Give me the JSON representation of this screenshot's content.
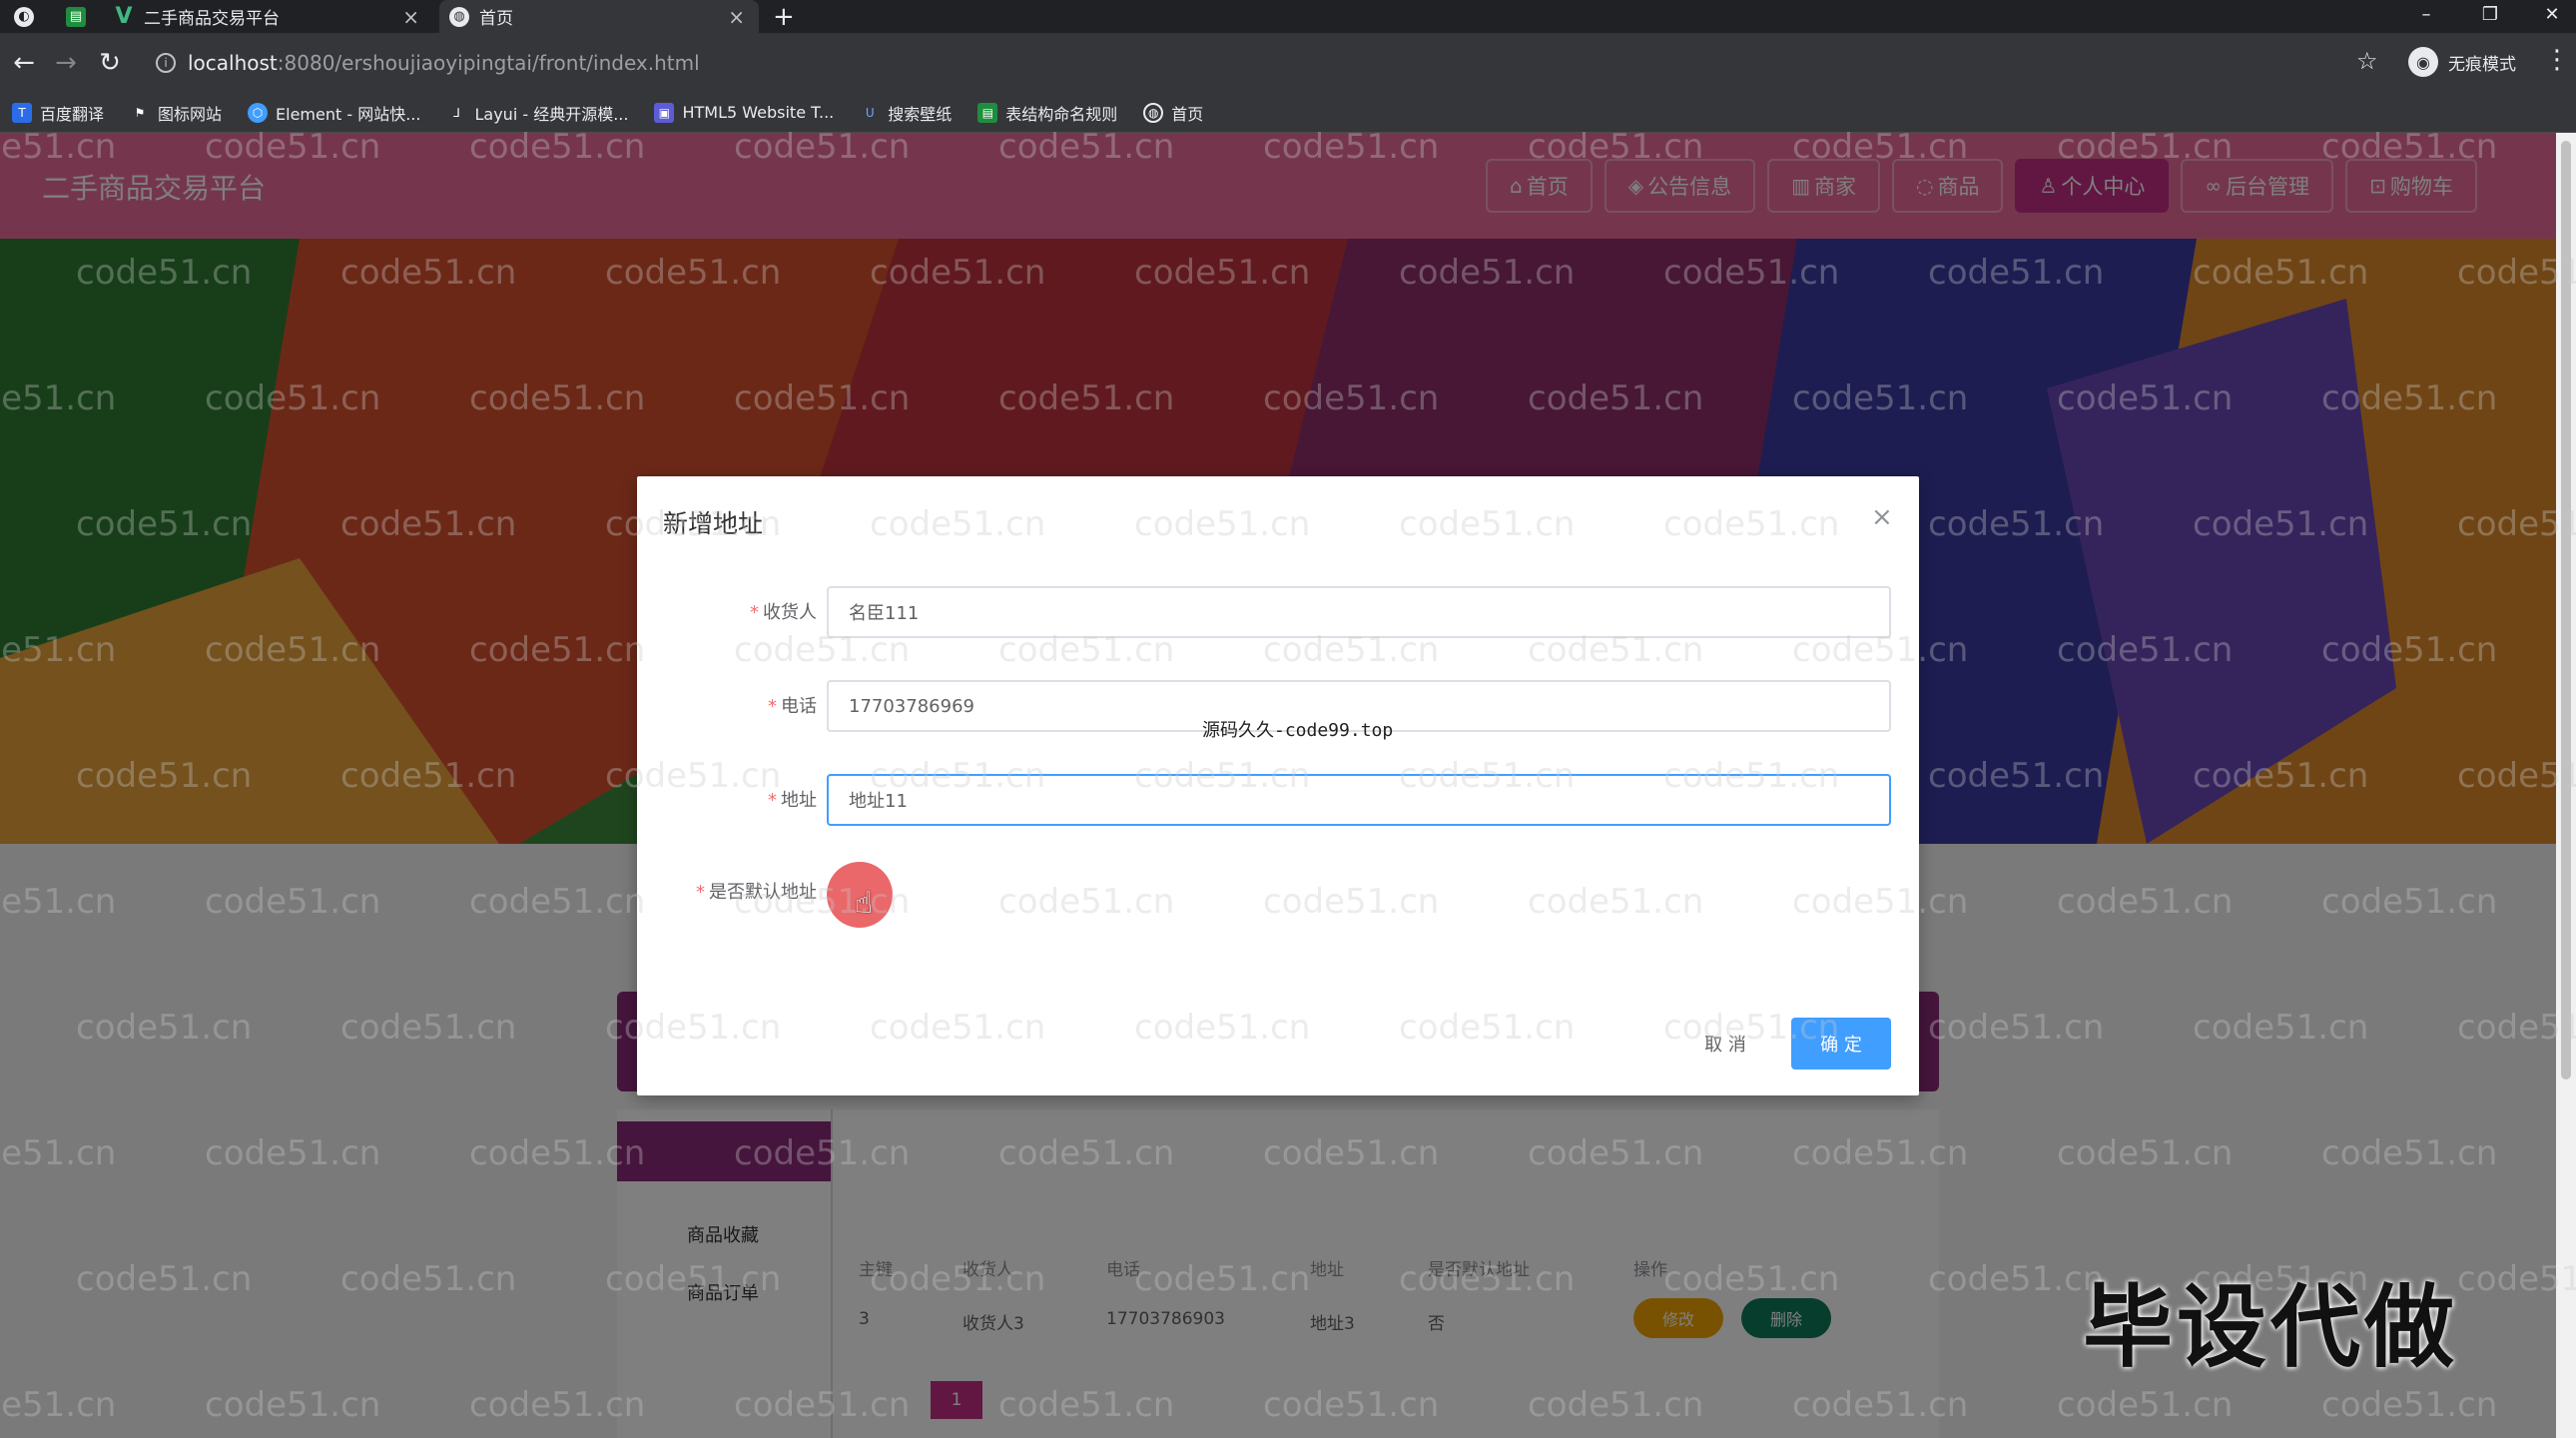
{
  "browser": {
    "tabs": [
      {
        "title": "",
        "icon": "sheet-icon"
      },
      {
        "title": "二手商品交易平台",
        "icon": "vue-icon"
      },
      {
        "title": "首页",
        "icon": "globe-icon"
      }
    ],
    "url_host": "localhost",
    "url_path": ":8080/ershoujiaoyipingtai/front/index.html",
    "profile_label": "无痕模式",
    "bookmarks": [
      "百度翻译",
      "图标网站",
      "Element - 网站快...",
      "Layui - 经典开源模...",
      "HTML5 Website T...",
      "搜索壁纸",
      "表结构命名规则",
      "首页"
    ]
  },
  "site": {
    "title": "二手商品交易平台",
    "nav": [
      {
        "label": "首页",
        "icon": "home-icon"
      },
      {
        "label": "公告信息",
        "icon": "notice-icon"
      },
      {
        "label": "商家",
        "icon": "shop-icon"
      },
      {
        "label": "商品",
        "icon": "goods-icon"
      },
      {
        "label": "个人中心",
        "icon": "user-icon",
        "active": true
      },
      {
        "label": "后台管理",
        "icon": "link-icon"
      },
      {
        "label": "购物车",
        "icon": "cart-icon"
      }
    ],
    "accent": "#ea6d9a"
  },
  "background_page": {
    "side": [
      "商品收藏",
      "商品订单"
    ],
    "columns": [
      "主键",
      "收货人",
      "电话",
      "地址",
      "是否默认地址",
      "操作"
    ],
    "row": {
      "id": "3",
      "name": "收货人3",
      "phone": "17703786903",
      "address": "地址3",
      "default": "否"
    },
    "edit_label": "修改",
    "delete_label": "删除",
    "page": "1"
  },
  "dialog": {
    "title": "新增地址",
    "close": "×",
    "fields": [
      {
        "label": "收货人",
        "value": "名臣111"
      },
      {
        "label": "电话",
        "value": "17703786969"
      },
      {
        "label": "地址",
        "value": "地址11"
      },
      {
        "label": "是否默认地址",
        "value": ""
      }
    ],
    "cancel_label": "取 消",
    "confirm_label": "确 定"
  },
  "overlay_text": "源码久久-code99.top",
  "watermark": "code51.cn",
  "corner_mark": "毕设代做"
}
